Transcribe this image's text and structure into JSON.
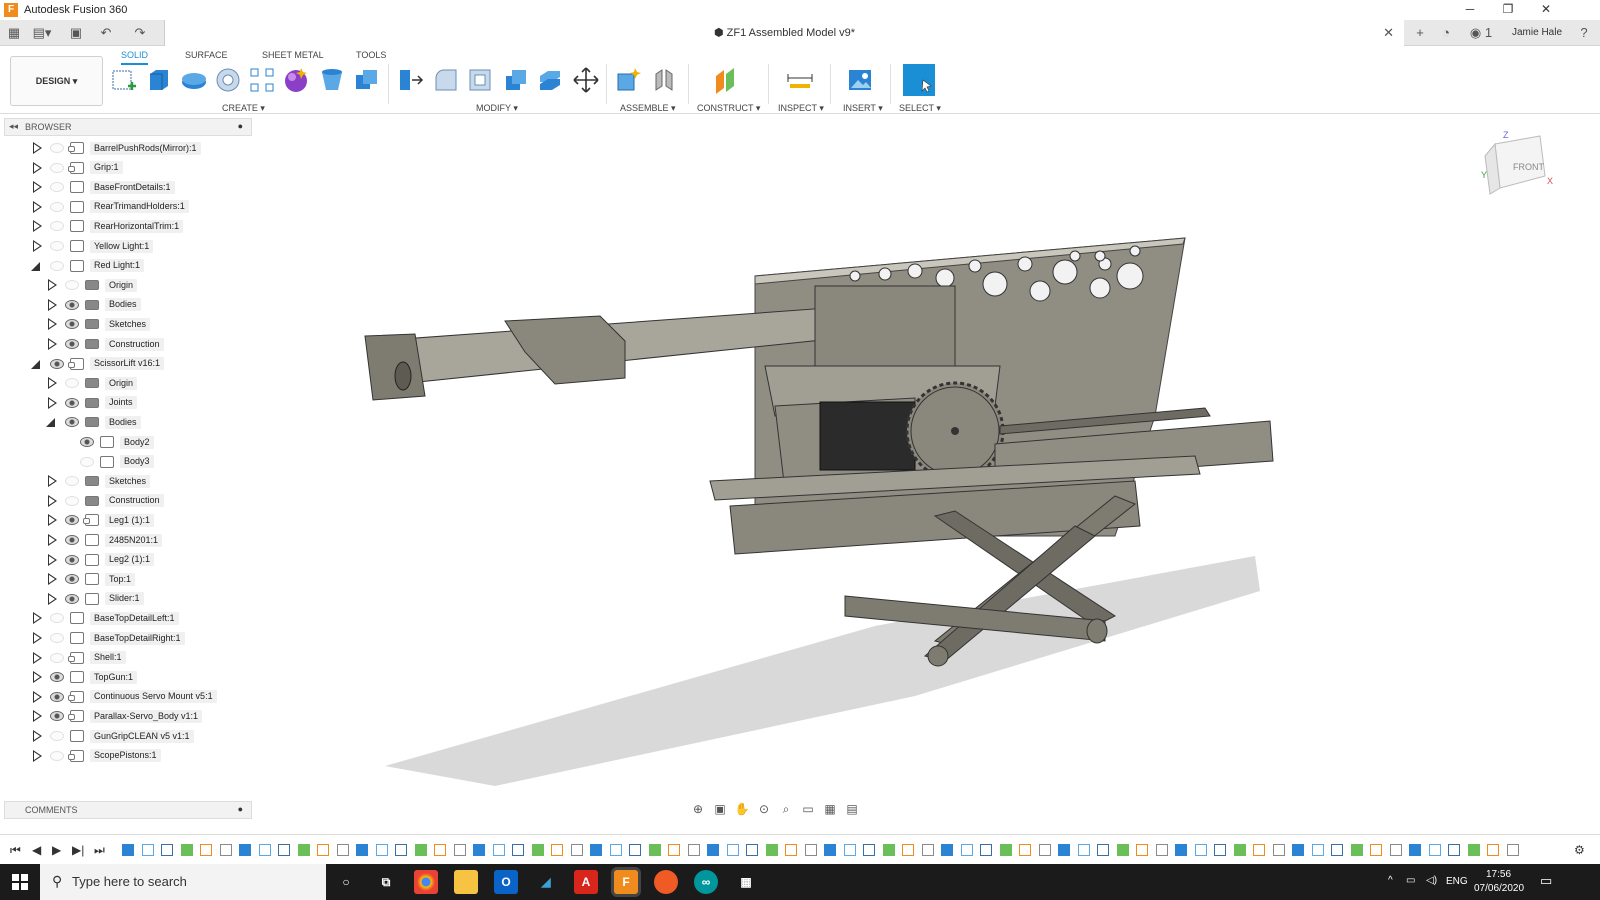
{
  "app_title": "Autodesk Fusion 360",
  "document_title": "ZF1 Assembled Model v9*",
  "user_name": "Jamie Hale",
  "notification_count": "1",
  "ribbon": {
    "tabs": [
      {
        "label": "SOLID",
        "active": true
      },
      {
        "label": "SURFACE",
        "active": false
      },
      {
        "label": "SHEET METAL",
        "active": false
      },
      {
        "label": "TOOLS",
        "active": false
      }
    ],
    "workspace_label": "DESIGN",
    "groups": [
      "CREATE",
      "MODIFY",
      "ASSEMBLE",
      "CONSTRUCT",
      "INSPECT",
      "INSERT",
      "SELECT"
    ]
  },
  "browser": {
    "title": "BROWSER",
    "items": [
      {
        "label": "BarrelPushRods(Mirror):1",
        "level": 0,
        "expanded": false,
        "visible": false,
        "icon": "component-link-icon"
      },
      {
        "label": "Grip:1",
        "level": 0,
        "expanded": false,
        "visible": false,
        "icon": "component-link-icon"
      },
      {
        "label": "BaseFrontDetails:1",
        "level": 0,
        "expanded": false,
        "visible": false,
        "icon": "component-icon"
      },
      {
        "label": "RearTrimandHolders:1",
        "level": 0,
        "expanded": false,
        "visible": false,
        "icon": "component-icon"
      },
      {
        "label": "RearHorizontalTrim:1",
        "level": 0,
        "expanded": false,
        "visible": false,
        "icon": "component-icon"
      },
      {
        "label": "Yellow Light:1",
        "level": 0,
        "expanded": false,
        "visible": false,
        "icon": "component-icon"
      },
      {
        "label": "Red Light:1",
        "level": 0,
        "expanded": true,
        "visible": false,
        "icon": "component-icon"
      },
      {
        "label": "Origin",
        "level": 1,
        "expanded": false,
        "visible": false,
        "icon": "folder-icon"
      },
      {
        "label": "Bodies",
        "level": 1,
        "expanded": false,
        "visible": true,
        "icon": "folder-icon"
      },
      {
        "label": "Sketches",
        "level": 1,
        "expanded": false,
        "visible": true,
        "icon": "folder-icon"
      },
      {
        "label": "Construction",
        "level": 1,
        "expanded": false,
        "visible": true,
        "icon": "folder-icon"
      },
      {
        "label": "ScissorLift v16:1",
        "level": 0,
        "expanded": true,
        "visible": true,
        "icon": "component-link-icon"
      },
      {
        "label": "Origin",
        "level": 1,
        "expanded": false,
        "visible": false,
        "icon": "folder-icon"
      },
      {
        "label": "Joints",
        "level": 1,
        "expanded": false,
        "visible": true,
        "icon": "folder-icon"
      },
      {
        "label": "Bodies",
        "level": 1,
        "expanded": true,
        "visible": true,
        "icon": "folder-icon"
      },
      {
        "label": "Body2",
        "level": 2,
        "expanded": null,
        "visible": true,
        "icon": "body-icon"
      },
      {
        "label": "Body3",
        "level": 2,
        "expanded": null,
        "visible": false,
        "icon": "body-icon"
      },
      {
        "label": "Sketches",
        "level": 1,
        "expanded": false,
        "visible": false,
        "icon": "folder-icon"
      },
      {
        "label": "Construction",
        "level": 1,
        "expanded": false,
        "visible": false,
        "icon": "folder-icon"
      },
      {
        "label": "Leg1 (1):1",
        "level": 1,
        "expanded": false,
        "visible": true,
        "icon": "component-link-icon"
      },
      {
        "label": "2485N201:1",
        "level": 1,
        "expanded": false,
        "visible": true,
        "icon": "component-icon"
      },
      {
        "label": "Leg2 (1):1",
        "level": 1,
        "expanded": false,
        "visible": true,
        "icon": "component-icon"
      },
      {
        "label": "Top:1",
        "level": 1,
        "expanded": false,
        "visible": true,
        "icon": "component-icon"
      },
      {
        "label": "Slider:1",
        "level": 1,
        "expanded": false,
        "visible": true,
        "icon": "component-icon"
      },
      {
        "label": "BaseTopDetailLeft:1",
        "level": 0,
        "expanded": false,
        "visible": false,
        "icon": "component-icon"
      },
      {
        "label": "BaseTopDetailRight:1",
        "level": 0,
        "expanded": false,
        "visible": false,
        "icon": "component-icon"
      },
      {
        "label": "Shell:1",
        "level": 0,
        "expanded": false,
        "visible": false,
        "icon": "component-link-icon"
      },
      {
        "label": "TopGun:1",
        "level": 0,
        "expanded": false,
        "visible": true,
        "icon": "component-icon"
      },
      {
        "label": "Continuous Servo Mount v5:1",
        "level": 0,
        "expanded": false,
        "visible": true,
        "icon": "component-link-icon"
      },
      {
        "label": "Parallax-Servo_Body v1:1",
        "level": 0,
        "expanded": false,
        "visible": true,
        "icon": "component-link-icon"
      },
      {
        "label": "GunGripCLEAN v5 v1:1",
        "level": 0,
        "expanded": false,
        "visible": false,
        "icon": "component-icon"
      },
      {
        "label": "ScopePistons:1",
        "level": 0,
        "expanded": false,
        "visible": false,
        "icon": "component-link-icon"
      }
    ]
  },
  "comments": {
    "title": "COMMENTS"
  },
  "viewcube": {
    "face": "FRONT",
    "axis_z": "Z",
    "axis_x": "X",
    "axis_y": "Y"
  },
  "taskbar": {
    "search_placeholder": "Type here to search",
    "language": "ENG",
    "time": "17:56",
    "date": "07/06/2020"
  },
  "colors": {
    "accent": "#1b8fd6",
    "model": "#8a877c",
    "taskbar": "#1b1b1b"
  }
}
